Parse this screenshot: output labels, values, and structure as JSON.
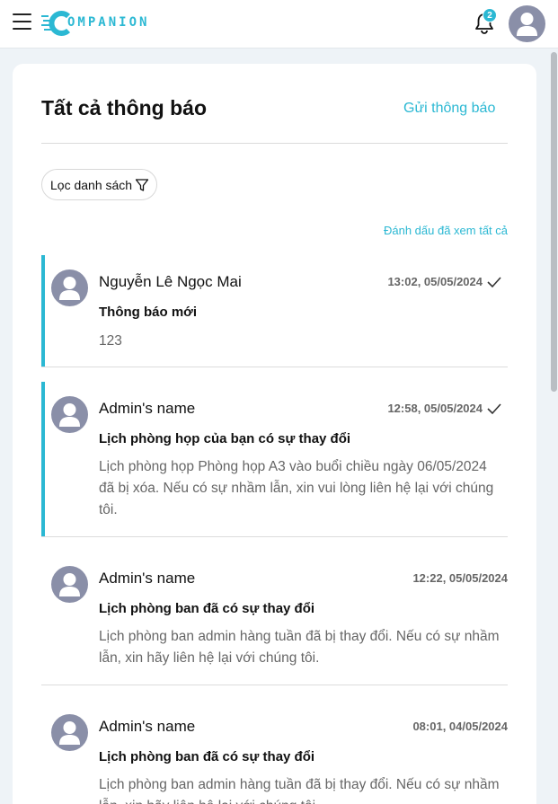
{
  "header": {
    "logo_text": "OMPANION",
    "notification_count": "2",
    "icons": [
      "menu-icon",
      "bell-icon",
      "user-avatar"
    ]
  },
  "page": {
    "title": "Tất cả thông báo",
    "send_label": "Gửi thông báo",
    "filter_label": "Lọc danh sách",
    "mark_all_label": "Đánh dấu đã xem tất cả"
  },
  "notifications": [
    {
      "sender": "Nguyễn Lê Ngọc Mai",
      "time": "13:02, 05/05/2024",
      "subject": "Thông báo mới",
      "body": "123",
      "unread": true,
      "checked": true
    },
    {
      "sender": "Admin's name",
      "time": "12:58, 05/05/2024",
      "subject": "Lịch phòng họp của bạn có sự thay đổi",
      "body": "Lịch phòng họp Phòng họp A3 vào buổi chiều ngày 06/05/2024 đã bị xóa. Nếu có sự nhầm lẫn, xin vui lòng liên hệ lại với chúng tôi.",
      "unread": true,
      "checked": true
    },
    {
      "sender": "Admin's name",
      "time": "12:22, 05/05/2024",
      "subject": "Lịch phòng ban đã có sự thay đổi",
      "body": "Lịch phòng ban admin hàng tuần đã bị thay đổi. Nếu có sự nhầm lẫn, xin hãy liên hệ lại với chúng tôi.",
      "unread": false,
      "checked": false
    },
    {
      "sender": "Admin's name",
      "time": "08:01, 04/05/2024",
      "subject": "Lịch phòng ban đã có sự thay đổi",
      "body": "Lịch phòng ban admin hàng tuần đã bị thay đổi. Nếu có sự nhầm lẫn, xin hãy liên hệ lại với chúng tôi.",
      "unread": false,
      "checked": false
    }
  ],
  "colors": {
    "accent": "#2bb8d3",
    "avatar": "#8a8fa8",
    "background": "#eef3f7"
  }
}
